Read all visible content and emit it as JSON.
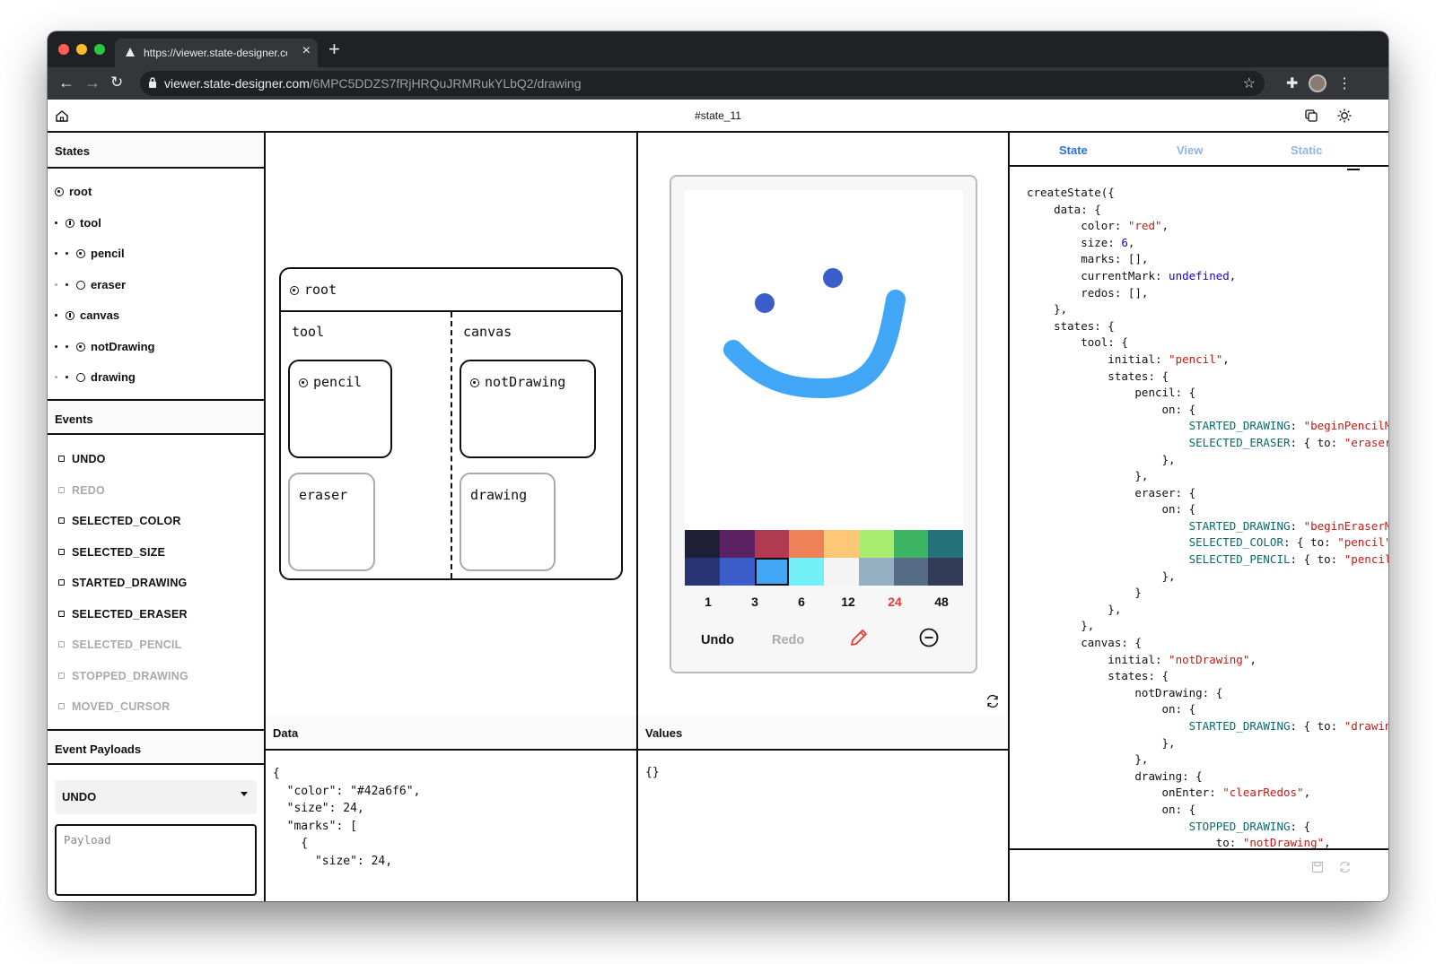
{
  "browser": {
    "tab_title": "https://viewer.state-designer.com",
    "url_host": "viewer.state-designer.com",
    "url_path": "/6MPC5DDZS7fRjHRQuJRMRukYLbQ2/drawing"
  },
  "app": {
    "title": "#state_11"
  },
  "states_panel": {
    "heading": "States",
    "items": [
      {
        "label": "root",
        "depth": 0,
        "kind": "active"
      },
      {
        "label": "tool",
        "depth": 1,
        "kind": "initial"
      },
      {
        "label": "pencil",
        "depth": 2,
        "kind": "active"
      },
      {
        "label": "eraser",
        "depth": 2,
        "kind": "inactive"
      },
      {
        "label": "canvas",
        "depth": 1,
        "kind": "initial"
      },
      {
        "label": "notDrawing",
        "depth": 2,
        "kind": "active"
      },
      {
        "label": "drawing",
        "depth": 2,
        "kind": "inactive"
      }
    ]
  },
  "events_panel": {
    "heading": "Events",
    "items": [
      {
        "label": "UNDO",
        "enabled": true
      },
      {
        "label": "REDO",
        "enabled": false
      },
      {
        "label": "SELECTED_COLOR",
        "enabled": true
      },
      {
        "label": "SELECTED_SIZE",
        "enabled": true
      },
      {
        "label": "STARTED_DRAWING",
        "enabled": true
      },
      {
        "label": "SELECTED_ERASER",
        "enabled": true
      },
      {
        "label": "SELECTED_PENCIL",
        "enabled": false
      },
      {
        "label": "STOPPED_DRAWING",
        "enabled": false
      },
      {
        "label": "MOVED_CURSOR",
        "enabled": false
      }
    ]
  },
  "payloads_panel": {
    "heading": "Event Payloads",
    "selected_event": "UNDO",
    "payload_placeholder": "Payload"
  },
  "chart_view": {
    "root": "root",
    "tool": "tool",
    "canvas": "canvas",
    "pencil": "pencil",
    "eraser": "eraser",
    "notDrawing": "notDrawing",
    "drawing": "drawing"
  },
  "preview": {
    "colors_row1": [
      "#1f2038",
      "#5b2160",
      "#b03a50",
      "#ee8158",
      "#fcc878",
      "#a8ed70",
      "#3cb464",
      "#26727a"
    ],
    "colors_row2": [
      "#293474",
      "#3b5dc9",
      "#42a6f6",
      "#73eff7",
      "#f4f4f4",
      "#94b0c2",
      "#566c86",
      "#333c57"
    ],
    "selected_color": "#42a6f6",
    "sizes": [
      "1",
      "3",
      "6",
      "12",
      "24",
      "48"
    ],
    "selected_size": "24",
    "undo_label": "Undo",
    "redo_label": "Redo",
    "pencil_icon": "pencil-icon",
    "eraser_icon": "minus-circle-icon",
    "stroke_color": "#42a6f6",
    "dot_color": "#3b5dc9"
  },
  "data_panel": {
    "heading": "Data",
    "json_lines": [
      "{",
      "  \"color\": \"#42a6f6\",",
      "  \"size\": 24,",
      "  \"marks\": [",
      "    {",
      "      \"size\": 24,"
    ]
  },
  "values_panel": {
    "heading": "Values",
    "text": "{}"
  },
  "code_panel": {
    "tabs": [
      "State",
      "View",
      "Static"
    ],
    "active_tab": "State"
  }
}
